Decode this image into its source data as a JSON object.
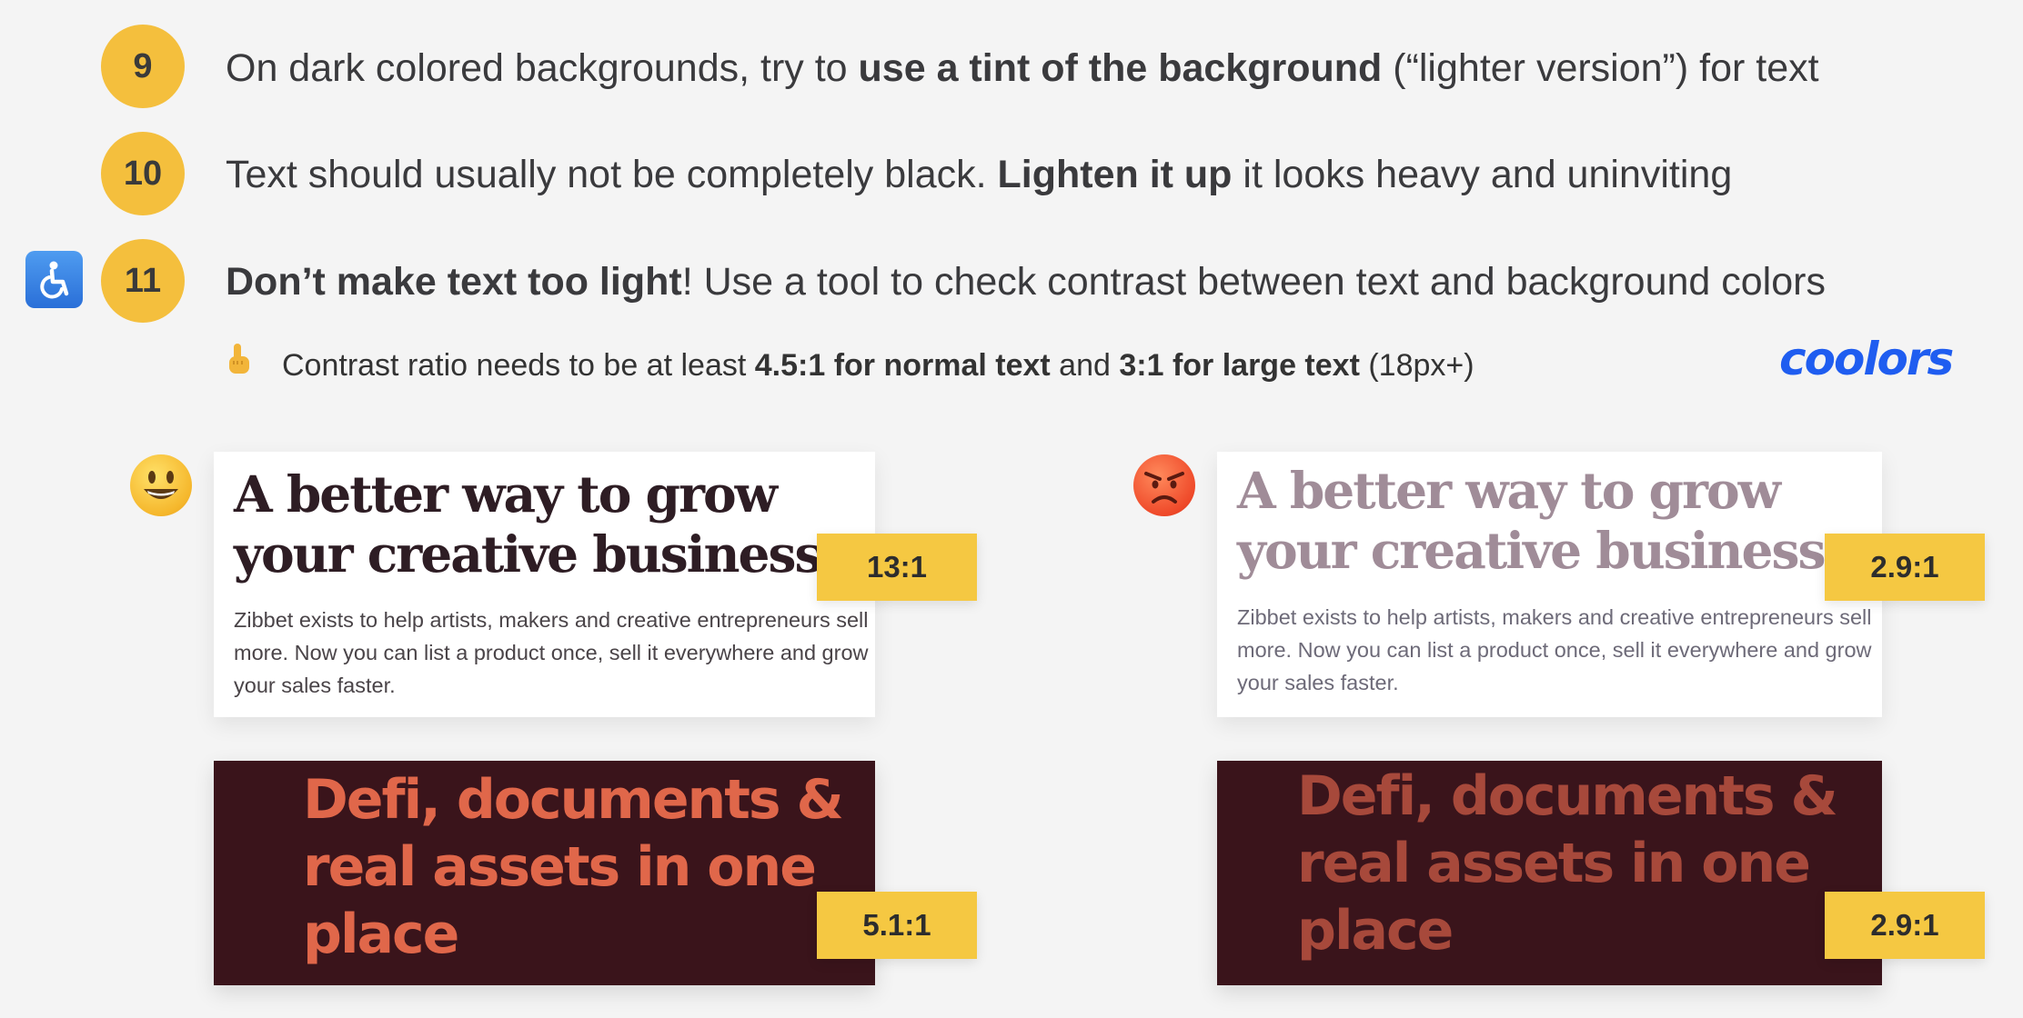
{
  "rules": [
    {
      "number": "9",
      "segments": [
        {
          "text": "On dark colored backgrounds, try to ",
          "bold": false
        },
        {
          "text": "use a tint of the background",
          "bold": true
        },
        {
          "text": " (“lighter version”) for text",
          "bold": false
        }
      ]
    },
    {
      "number": "10",
      "segments": [
        {
          "text": "Text should usually not be completely black. ",
          "bold": false
        },
        {
          "text": "Lighten it up",
          "bold": true
        },
        {
          "text": " it looks heavy and uninviting",
          "bold": false
        }
      ]
    },
    {
      "number": "11",
      "segments": [
        {
          "text": "Don’t make text too light",
          "bold": true
        },
        {
          "text": "! Use a tool to check contrast between text and background colors",
          "bold": false
        }
      ]
    }
  ],
  "note": {
    "finger": "☝",
    "t1": "Contrast ratio needs to be at least ",
    "b1": "4.5:1 for normal text",
    "t2": " and ",
    "b2": "3:1 for large text",
    "t3": " (18px+)"
  },
  "brand_logo": "coolors",
  "good": {
    "heading": "A better way to grow your creative business",
    "body": "Zibbet exists to help artists, makers and creative entrepreneurs sell more. Now you can list a product once, sell it everywhere and grow your sales faster.",
    "ratio": "13:1",
    "dark_heading": "Defi, documents & real assets in one place",
    "dark_ratio": "5.1:1"
  },
  "bad": {
    "heading": "A better way to grow your creative business",
    "body": "Zibbet exists to help artists, makers and creative entrepreneurs sell more. Now you can list a product once, sell it everywhere and grow your sales faster.",
    "ratio": "2.9:1",
    "dark_heading": "Defi, documents & real assets in one place",
    "dark_ratio": "2.9:1"
  },
  "colors": {
    "background": "#f4f4f4",
    "circle": "#f4bf3d",
    "badge": "#f5c842",
    "good_heading": "#2e1d24",
    "good_body": "#4a4448",
    "bad_heading": "#a08c98",
    "bad_body": "#6d6a78",
    "dark_bg": "#3a141b",
    "good_dark_text": "#e0674a",
    "bad_dark_text": "#a7493b",
    "brand": "#1f5df0"
  },
  "icons": {
    "accessibility": "wheelchair-icon",
    "pointer": "pointing-up-icon",
    "happy": "smiling-face-icon",
    "angry": "angry-face-icon"
  }
}
